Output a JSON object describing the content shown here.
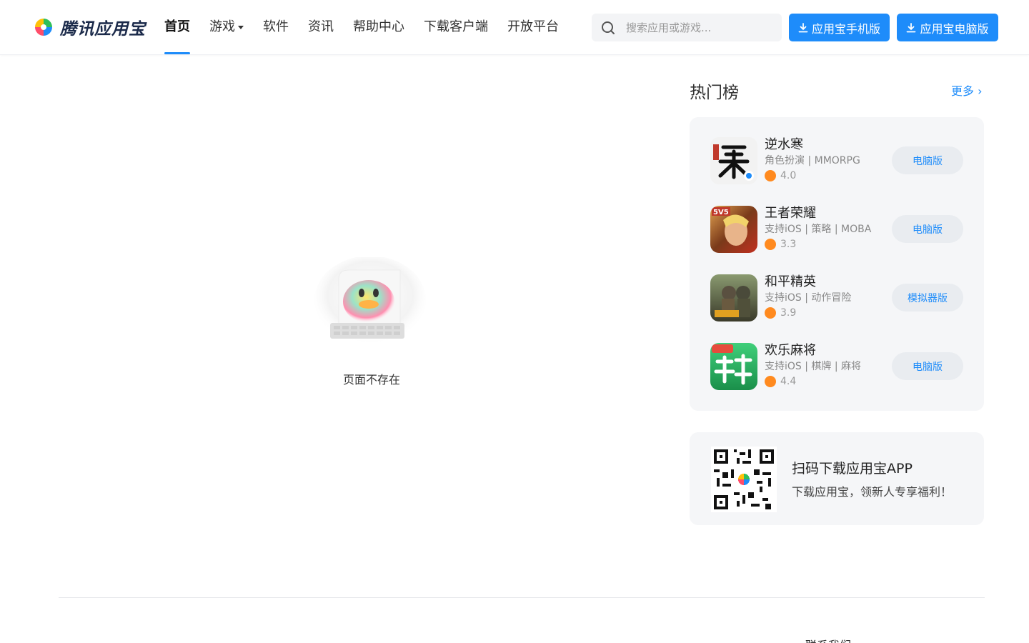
{
  "brand": {
    "name": "腾讯应用宝"
  },
  "nav": {
    "items": [
      {
        "label": "首页",
        "active": true
      },
      {
        "label": "游戏",
        "has_caret": true
      },
      {
        "label": "软件"
      },
      {
        "label": "资讯"
      },
      {
        "label": "帮助中心"
      },
      {
        "label": "下载客户端"
      },
      {
        "label": "开放平台"
      }
    ]
  },
  "search": {
    "placeholder": "搜索应用或游戏...",
    "icon": "search-icon"
  },
  "download": {
    "mobile_label": "应用宝手机版",
    "pc_label": "应用宝电脑版",
    "icon": "download-icon"
  },
  "empty_state": {
    "message": "页面不存在"
  },
  "hot": {
    "title": "热门榜",
    "more_label": "更多",
    "apps": [
      {
        "name": "逆水寒",
        "meta": "角色扮演 | MMORPG",
        "rating": "4.0",
        "button": "电脑版"
      },
      {
        "name": "王者荣耀",
        "meta": "支持iOS | 策略 | MOBA",
        "rating": "3.3",
        "button": "电脑版"
      },
      {
        "name": "和平精英",
        "meta": "支持iOS | 动作冒险",
        "rating": "3.9",
        "button": "模拟器版"
      },
      {
        "name": "欢乐麻将",
        "meta": "支持iOS | 棋牌 | 麻将",
        "rating": "4.4",
        "button": "电脑版"
      }
    ]
  },
  "qr": {
    "title": "扫码下载应用宝APP",
    "subtitle": "下载应用宝，领新人专享福利！"
  },
  "footer": {
    "partial_text": "联系我们"
  },
  "colors": {
    "accent": "#1e8cfa",
    "card_bg": "#f5f6f8",
    "rating": "#ff8a1f"
  }
}
